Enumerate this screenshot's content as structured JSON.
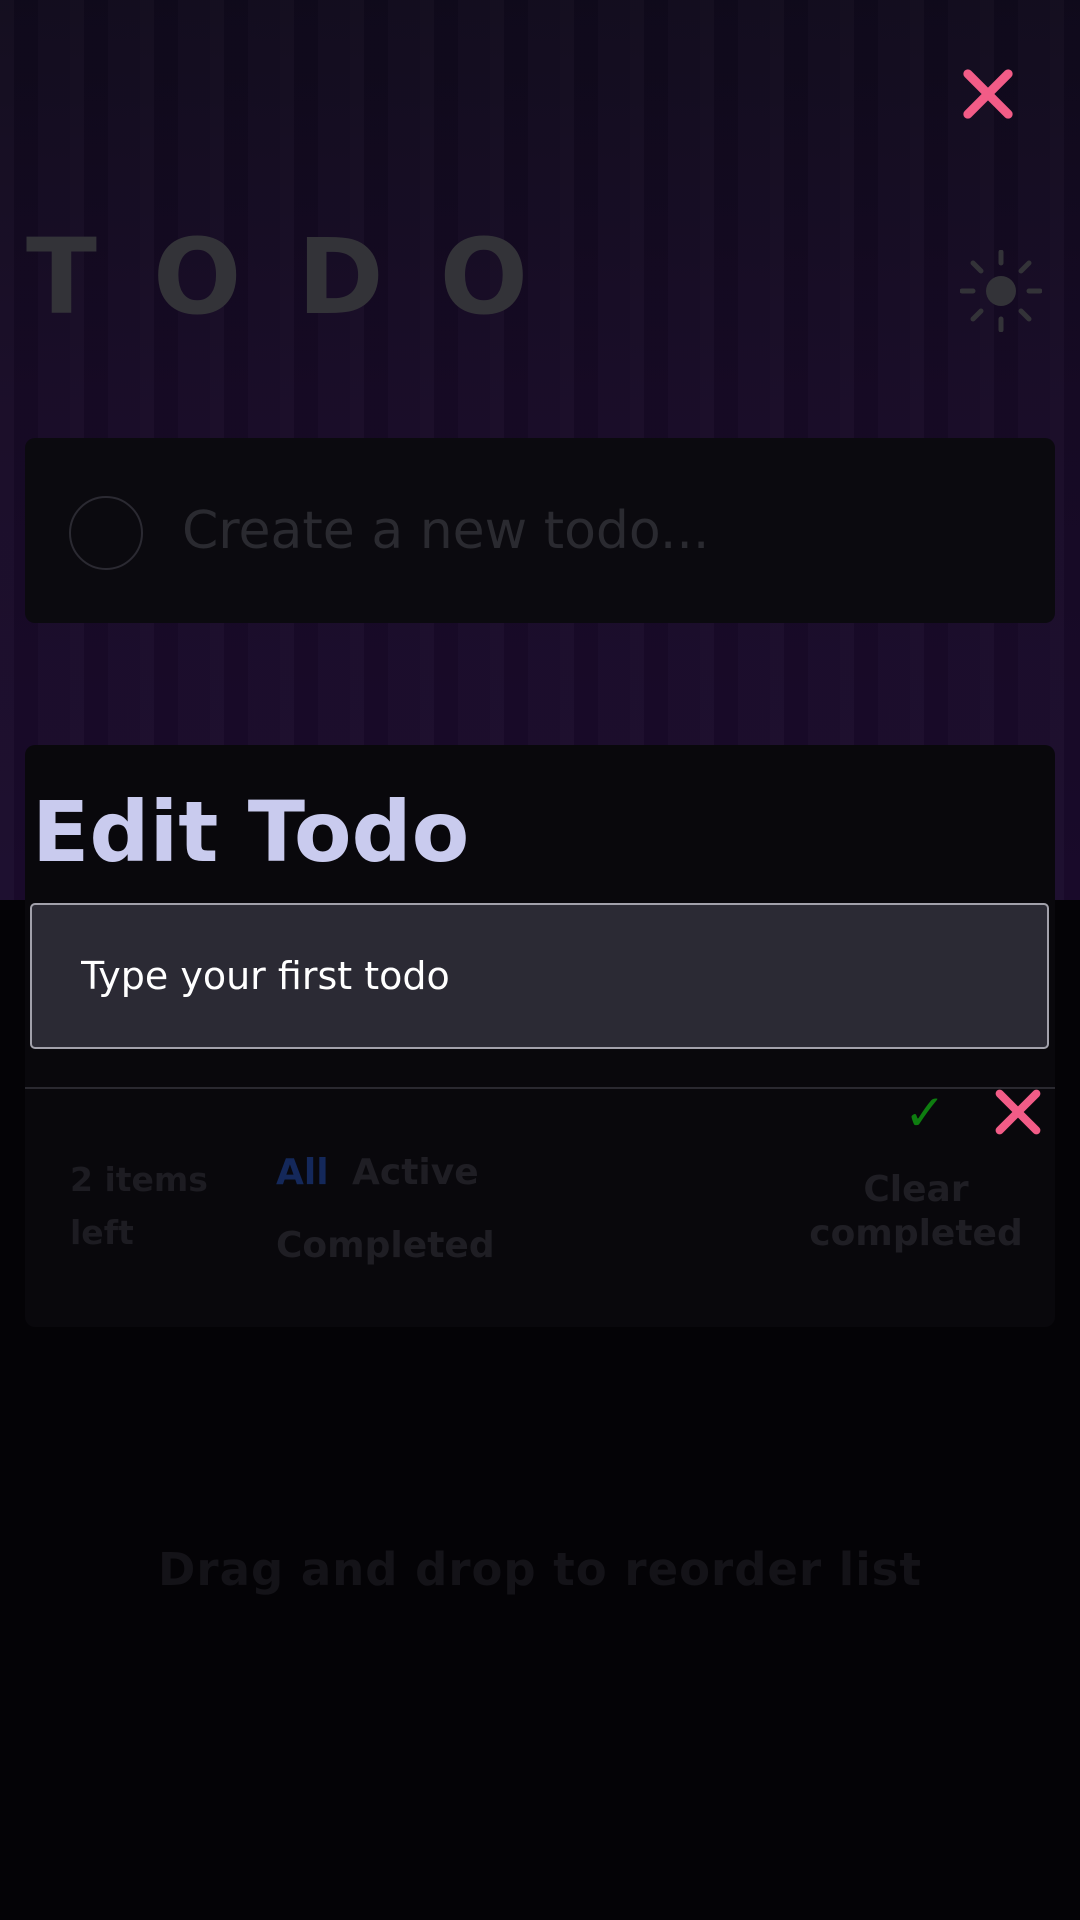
{
  "app": {
    "title": "TODO"
  },
  "new_todo": {
    "placeholder": "Create a new todo..."
  },
  "edit_modal": {
    "heading": "Edit Todo",
    "input_value": "Type your first todo",
    "confirm_symbol": "✓"
  },
  "footer": {
    "items_left": "2 items left",
    "filters": {
      "all": "All",
      "active": "Active",
      "completed": "Completed"
    },
    "clear_completed": "Clear completed"
  },
  "drag_hint": "Drag and drop to reorder list",
  "colors": {
    "close_accent": "#f25c87",
    "confirm_green": "#0e7d10",
    "heading": "#c9cbee",
    "active_filter": "#14285a"
  },
  "icons": {
    "top_close": "close-icon",
    "theme": "sun-icon",
    "confirm": "check-icon",
    "cancel": "close-icon"
  }
}
